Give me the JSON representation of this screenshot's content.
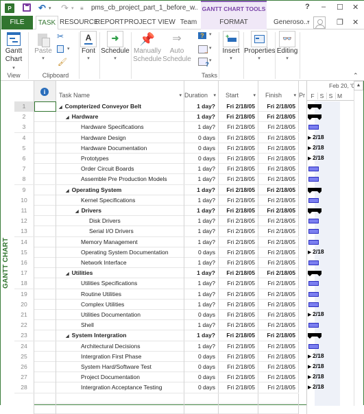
{
  "titlebar": {
    "app_icon": "project-icon",
    "app_icon_text": "P",
    "doc_title": "pms_cb_project_part_1_before_w...",
    "context_title": "GANTT CHART TOOLS",
    "help": "?",
    "minimize": "–",
    "maximize": "☐",
    "close": "✕"
  },
  "tabs": {
    "file": "FILE",
    "task": "TASK",
    "resource": "RESOURCE",
    "report": "REPORT",
    "project": "PROJECT",
    "view": "VIEW",
    "team": "Team",
    "format": "FORMAT",
    "user": "Generoso...",
    "restore": "❐",
    "close_doc": "✕"
  },
  "ribbon": {
    "gantt_chart_1": "Gantt",
    "gantt_chart_2": "Chart",
    "paste": "Paste",
    "font": "Font",
    "schedule": "Schedule",
    "manually_1": "Manually",
    "manually_2": "Schedule",
    "auto_1": "Auto",
    "auto_2": "Schedule",
    "insert": "Insert",
    "properties": "Properties",
    "editing": "Editing",
    "groups": {
      "view": "View",
      "clipboard": "Clipboard",
      "tasks": "Tasks"
    }
  },
  "side_label": "GANTT CHART",
  "table": {
    "headers": {
      "task_name": "Task Name",
      "duration": "Duration",
      "start": "Start",
      "finish": "Finish",
      "predecessors": "Pr"
    },
    "timescale": {
      "date": "Feb 20, '0",
      "days": [
        "F",
        "S",
        "S",
        "M"
      ]
    },
    "rows": [
      {
        "id": "1",
        "name": "Compterized Conveyor Belt",
        "level": 0,
        "summary": true,
        "duration": "1 day?",
        "start": "Fri 2/18/05",
        "finish": "Fri 2/18/05",
        "bar": "summary"
      },
      {
        "id": "2",
        "name": "Hardware",
        "level": 1,
        "summary": true,
        "duration": "1 day?",
        "start": "Fri 2/18/05",
        "finish": "Fri 2/18/05",
        "bar": "summary"
      },
      {
        "id": "3",
        "name": "Hardware Specifications",
        "level": 2,
        "summary": false,
        "duration": "1 day?",
        "start": "Fri 2/18/05",
        "finish": "Fri 2/18/05",
        "bar": "task"
      },
      {
        "id": "4",
        "name": "Hardware Design",
        "level": 2,
        "summary": false,
        "duration": "0 days",
        "start": "Fri 2/18/05",
        "finish": "Fri 2/18/05",
        "bar": "milestone",
        "ms_label": "2/18"
      },
      {
        "id": "5",
        "name": "Hardware Documentation",
        "level": 2,
        "summary": false,
        "duration": "0 days",
        "start": "Fri 2/18/05",
        "finish": "Fri 2/18/05",
        "bar": "milestone",
        "ms_label": "2/18"
      },
      {
        "id": "6",
        "name": "Prototypes",
        "level": 2,
        "summary": false,
        "duration": "0 days",
        "start": "Fri 2/18/05",
        "finish": "Fri 2/18/05",
        "bar": "milestone",
        "ms_label": "2/18"
      },
      {
        "id": "7",
        "name": "Order Circuit Boards",
        "level": 2,
        "summary": false,
        "duration": "1 day?",
        "start": "Fri 2/18/05",
        "finish": "Fri 2/18/05",
        "bar": "task"
      },
      {
        "id": "8",
        "name": "Assemble Pre Production Models",
        "level": 2,
        "summary": false,
        "duration": "1 day?",
        "start": "Fri 2/18/05",
        "finish": "Fri 2/18/05",
        "bar": "task"
      },
      {
        "id": "9",
        "name": "Operating System",
        "level": 1,
        "summary": true,
        "duration": "1 day?",
        "start": "Fri 2/18/05",
        "finish": "Fri 2/18/05",
        "bar": "summary"
      },
      {
        "id": "10",
        "name": "Kernel Specifications",
        "level": 2,
        "summary": false,
        "duration": "1 day?",
        "start": "Fri 2/18/05",
        "finish": "Fri 2/18/05",
        "bar": "task"
      },
      {
        "id": "11",
        "name": "Drivers",
        "level": 2,
        "summary": true,
        "duration": "1 day?",
        "start": "Fri 2/18/05",
        "finish": "Fri 2/18/05",
        "bar": "summary"
      },
      {
        "id": "12",
        "name": "Disk Drivers",
        "level": 3,
        "summary": false,
        "duration": "1 day?",
        "start": "Fri 2/18/05",
        "finish": "Fri 2/18/05",
        "bar": "task"
      },
      {
        "id": "13",
        "name": "Serial I/O Drivers",
        "level": 3,
        "summary": false,
        "duration": "1 day?",
        "start": "Fri 2/18/05",
        "finish": "Fri 2/18/05",
        "bar": "task"
      },
      {
        "id": "14",
        "name": "Memory Management",
        "level": 2,
        "summary": false,
        "duration": "1 day?",
        "start": "Fri 2/18/05",
        "finish": "Fri 2/18/05",
        "bar": "task"
      },
      {
        "id": "15",
        "name": "Operating System Documentation",
        "level": 2,
        "summary": false,
        "duration": "0 days",
        "start": "Fri 2/18/05",
        "finish": "Fri 2/18/05",
        "bar": "milestone",
        "ms_label": "2/18"
      },
      {
        "id": "16",
        "name": "Network Interface",
        "level": 2,
        "summary": false,
        "duration": "1 day?",
        "start": "Fri 2/18/05",
        "finish": "Fri 2/18/05",
        "bar": "task"
      },
      {
        "id": "17",
        "name": "Utilities",
        "level": 1,
        "summary": true,
        "duration": "1 day?",
        "start": "Fri 2/18/05",
        "finish": "Fri 2/18/05",
        "bar": "summary"
      },
      {
        "id": "18",
        "name": "Utilities Specifications",
        "level": 2,
        "summary": false,
        "duration": "1 day?",
        "start": "Fri 2/18/05",
        "finish": "Fri 2/18/05",
        "bar": "task"
      },
      {
        "id": "19",
        "name": "Routine Utilities",
        "level": 2,
        "summary": false,
        "duration": "1 day?",
        "start": "Fri 2/18/05",
        "finish": "Fri 2/18/05",
        "bar": "task"
      },
      {
        "id": "20",
        "name": "Complex Utilities",
        "level": 2,
        "summary": false,
        "duration": "1 day?",
        "start": "Fri 2/18/05",
        "finish": "Fri 2/18/05",
        "bar": "task"
      },
      {
        "id": "21",
        "name": "Utilities Documentation",
        "level": 2,
        "summary": false,
        "duration": "0 days",
        "start": "Fri 2/18/05",
        "finish": "Fri 2/18/05",
        "bar": "milestone",
        "ms_label": "2/18"
      },
      {
        "id": "22",
        "name": "Shell",
        "level": 2,
        "summary": false,
        "duration": "1 day?",
        "start": "Fri 2/18/05",
        "finish": "Fri 2/18/05",
        "bar": "task"
      },
      {
        "id": "23",
        "name": "System Intergration",
        "level": 1,
        "summary": true,
        "duration": "1 day?",
        "start": "Fri 2/18/05",
        "finish": "Fri 2/18/05",
        "bar": "summary"
      },
      {
        "id": "24",
        "name": "Architectural Decisions",
        "level": 2,
        "summary": false,
        "duration": "1 day?",
        "start": "Fri 2/18/05",
        "finish": "Fri 2/18/05",
        "bar": "task"
      },
      {
        "id": "25",
        "name": "Intergration First Phase",
        "level": 2,
        "summary": false,
        "duration": "0 days",
        "start": "Fri 2/18/05",
        "finish": "Fri 2/18/05",
        "bar": "milestone",
        "ms_label": "2/18"
      },
      {
        "id": "26",
        "name": "System Hard/Software Test",
        "level": 2,
        "summary": false,
        "duration": "0 days",
        "start": "Fri 2/18/05",
        "finish": "Fri 2/18/05",
        "bar": "milestone",
        "ms_label": "2/18"
      },
      {
        "id": "27",
        "name": "Project Documentation",
        "level": 2,
        "summary": false,
        "duration": "0 days",
        "start": "Fri 2/18/05",
        "finish": "Fri 2/18/05",
        "bar": "milestone",
        "ms_label": "2/18"
      },
      {
        "id": "28",
        "name": "Intergration Acceptance Testing",
        "level": 2,
        "summary": false,
        "duration": "0 days",
        "start": "Fri 2/18/05",
        "finish": "Fri 2/18/05",
        "bar": "milestone",
        "ms_label": "2/18"
      }
    ]
  },
  "colors": {
    "accent": "#31752f",
    "context_tab": "#7a45a8",
    "task_bar": "#7b7ff0"
  }
}
